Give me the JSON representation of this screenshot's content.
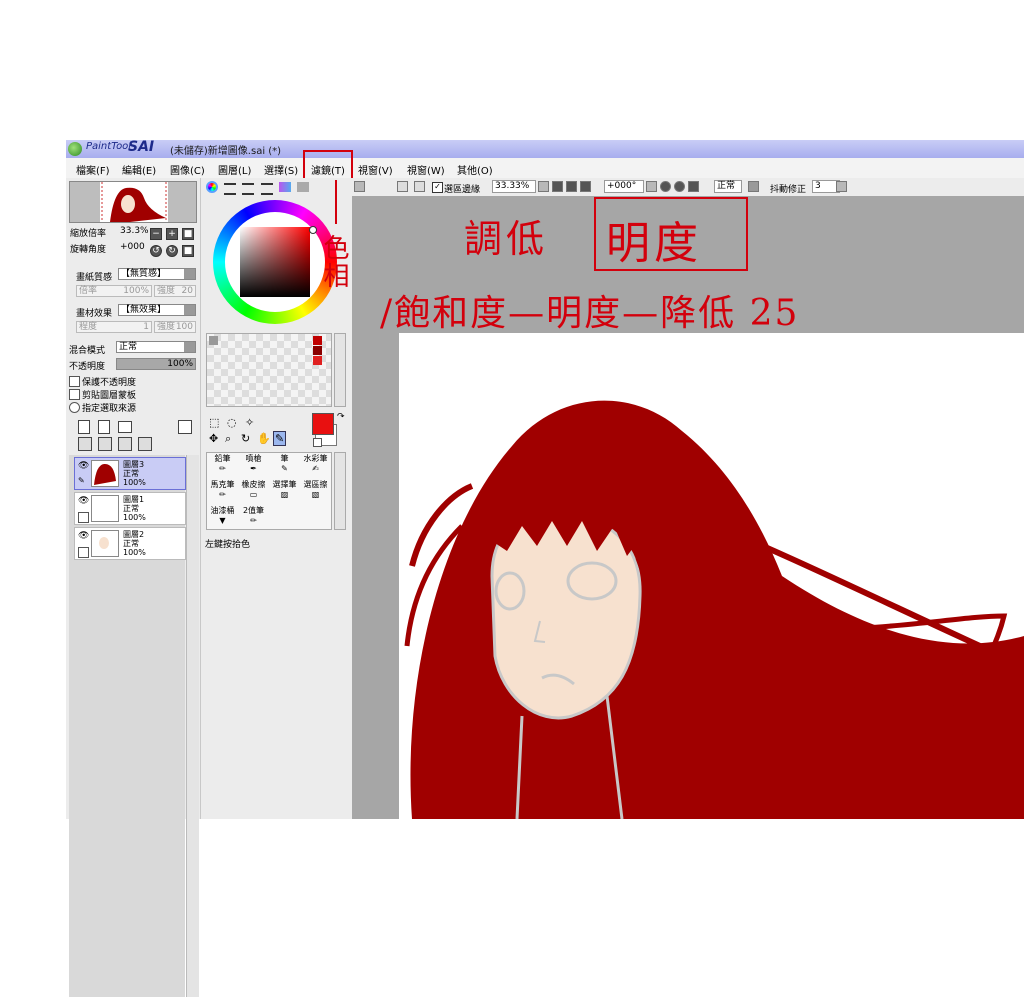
{
  "title_bar": {
    "app_name": "PaintTool",
    "app_name_bold": "SAI",
    "window_title": "(未儲存)新增圖像.sai (*)"
  },
  "menu": {
    "items": [
      "檔案(F)",
      "編輯(E)",
      "圖像(C)",
      "圖層(L)",
      "選擇(S)",
      "濾鏡(T)",
      "視窗(V)",
      "視窗(W)",
      "其他(O)"
    ]
  },
  "toolbar": {
    "selection_edge_label": "選區邊緣",
    "zoom_value": "33.33%",
    "rotation_value": "+000°",
    "blend_value": "正常",
    "stabilizer_label": "抖動修正",
    "stabilizer_value": "3"
  },
  "navigator": {
    "zoom_label": "縮放倍率",
    "zoom_value": "33.3%",
    "rotate_label": "旋轉角度",
    "rotate_value": "+000"
  },
  "paper": {
    "texture_label": "畫紙質感",
    "texture_value": "【無質感】",
    "scale_label": "倍率",
    "scale_value": "100%",
    "strength_label": "強度",
    "strength_value": "20",
    "effect_label": "畫材效果",
    "effect_value": "【無效果】",
    "degree_label": "程度",
    "degree_value": "1",
    "effect_strength_label": "強度",
    "effect_strength_value": "100"
  },
  "layer_props": {
    "blend_label": "混合模式",
    "blend_value": "正常",
    "opacity_label": "不透明度",
    "opacity_value": "100%",
    "opacity": 1.0,
    "option1": "保護不透明度",
    "option2": "剪貼圖層蒙板",
    "option3": "指定選取來源"
  },
  "layers": [
    {
      "name": "圖層3",
      "mode": "正常",
      "opacity": "100%",
      "selected": true
    },
    {
      "name": "圖層1",
      "mode": "正常",
      "opacity": "100%",
      "selected": false
    },
    {
      "name": "圖層2",
      "mode": "正常",
      "opacity": "100%",
      "selected": false
    }
  ],
  "tools": {
    "row1": [
      "鉛筆",
      "噴槍",
      "筆",
      "水彩筆"
    ],
    "row2": [
      "馬克筆",
      "橡皮擦",
      "選擇筆",
      "選區擦"
    ],
    "row3": [
      "油漆桶",
      "2值筆"
    ],
    "status": "左鍵按拾色"
  },
  "colors": {
    "current_color": "#e81010",
    "accent": "#d3000c",
    "hair": "#a00000",
    "skin": "#f7e1cf"
  },
  "annotations": {
    "line1_prefix": "調低",
    "line1_boxed": "明度",
    "line2_vertical": "色相",
    "line2": "/飽和度—明度—降低 25"
  }
}
